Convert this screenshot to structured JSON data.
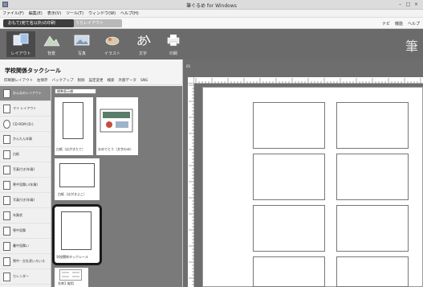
{
  "window": {
    "title": "筆ぐるめ for Windows",
    "min": "–",
    "max": "□",
    "close": "×"
  },
  "menu": [
    "ファイル(F)",
    "編集(E)",
    "表示(V)",
    "ツール(T)",
    "ウィンドウ(W)",
    "ヘルプ(H)"
  ],
  "mode_tabs": {
    "active": "おもて(宛て名以外)の印刷",
    "inactive": "うらレイアウト"
  },
  "mode_right": [
    "ナビ",
    "機能",
    "ヘルプ"
  ],
  "ribbon": {
    "tools": [
      "レイアウト",
      "背景",
      "写真",
      "イラスト",
      "文字",
      "印刷"
    ],
    "brand": "筆"
  },
  "panel": {
    "title": "学校関係タックシール",
    "toolbar": [
      "印刷順レイアウト",
      "右保存",
      "バックアップ",
      "削除",
      "設定変更",
      "検索",
      "外部データ",
      "SNS"
    ]
  },
  "categories": [
    "おんなのレイアウト",
    "マイ レイアウト",
    "CD-ROM (D:)",
    "かんたん年賀",
    "白紙",
    "写真付き(年賀)",
    "寒中見舞い(年賀)",
    "写真付き(年賀)",
    "年賀状",
    "喪中見舞",
    "暑中見舞い",
    "喪中・欠礼状いろいろ",
    "カレンダー"
  ],
  "gallery": {
    "sort": "標準表示順",
    "items": [
      {
        "label": "白紙（はがきたて）"
      },
      {
        "label": "おめでとう（文字のみ）"
      },
      {
        "label": "白紙（はがきよこ）"
      },
      {
        "label": "学校関係タックシール"
      },
      {
        "label": "名刺1 縦用"
      }
    ]
  },
  "canvas": {
    "zoom_label": "65"
  }
}
